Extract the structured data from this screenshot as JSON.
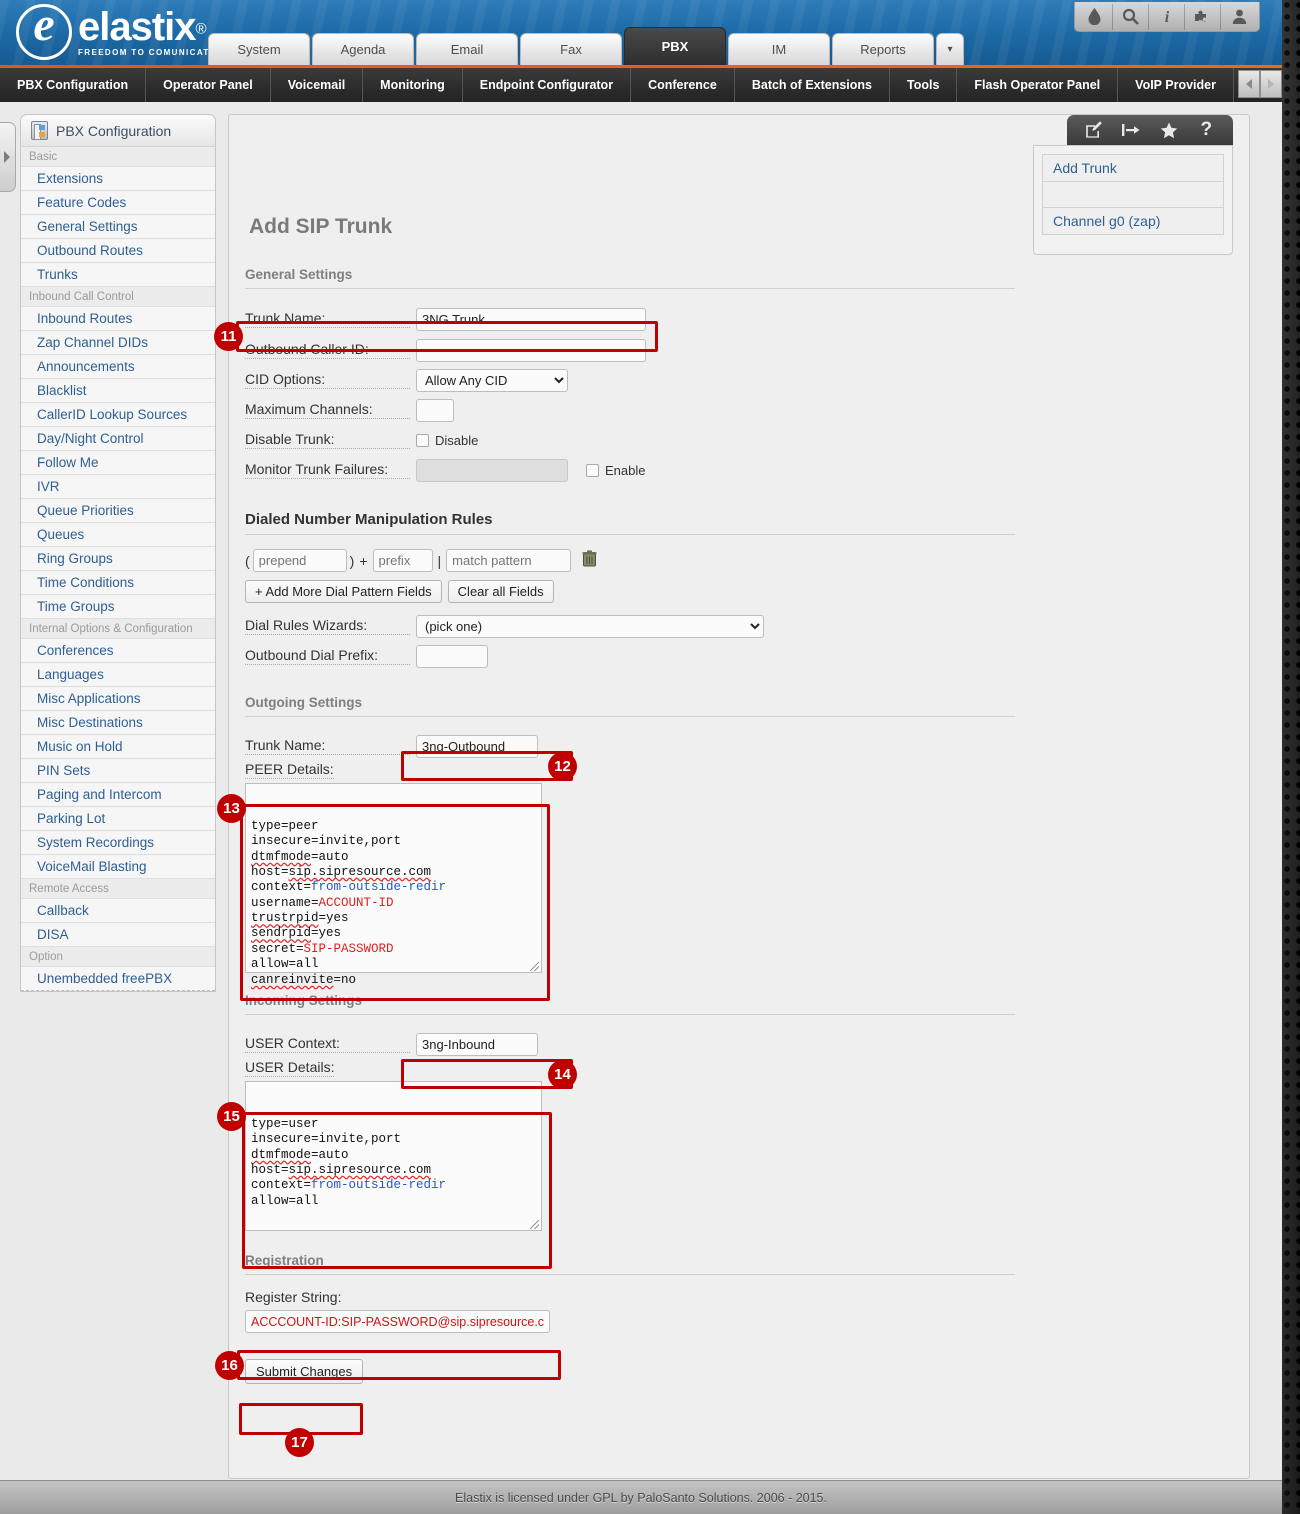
{
  "header": {
    "logo_text": "elastix",
    "logo_reg": "®",
    "logo_tagline": "FREEDOM TO COMUNICATE",
    "tabs": [
      {
        "label": "System",
        "active": false
      },
      {
        "label": "Agenda",
        "active": false
      },
      {
        "label": "Email",
        "active": false
      },
      {
        "label": "Fax",
        "active": false
      },
      {
        "label": "PBX",
        "active": true
      },
      {
        "label": "IM",
        "active": false
      },
      {
        "label": "Reports",
        "active": false
      }
    ],
    "tab_overflow": "▾",
    "tools": [
      {
        "name": "droplet-icon",
        "title": "droplet"
      },
      {
        "name": "search-icon",
        "title": "search"
      },
      {
        "name": "info-icon",
        "title": "info"
      },
      {
        "name": "puzzle-icon",
        "title": "extensions"
      },
      {
        "name": "user-icon",
        "title": "user"
      }
    ]
  },
  "subnav": {
    "items": [
      "PBX Configuration",
      "Operator Panel",
      "Voicemail",
      "Monitoring",
      "Endpoint Configurator",
      "Conference",
      "Batch of Extensions",
      "Tools",
      "Flash Operator Panel",
      "VoIP Provider"
    ],
    "scroll_left": "◀",
    "scroll_right": "▶"
  },
  "sidebar": {
    "tab_title": "PBX Configuration",
    "groups": [
      {
        "label": "Basic",
        "items": [
          "Extensions",
          "Feature Codes",
          "General Settings",
          "Outbound Routes",
          "Trunks"
        ]
      },
      {
        "label": "Inbound Call Control",
        "items": [
          "Inbound Routes",
          "Zap Channel DIDs",
          "Announcements",
          "Blacklist",
          "CallerID Lookup Sources",
          "Day/Night Control",
          "Follow Me",
          "IVR",
          "Queue Priorities",
          "Queues",
          "Ring Groups",
          "Time Conditions",
          "Time Groups"
        ]
      },
      {
        "label": "Internal Options & Configuration",
        "items": [
          "Conferences",
          "Languages",
          "Misc Applications",
          "Misc Destinations",
          "Music on Hold",
          "PIN Sets",
          "Paging and Intercom",
          "Parking Lot",
          "System Recordings",
          "VoiceMail Blasting"
        ]
      },
      {
        "label": "Remote Access",
        "items": [
          "Callback",
          "DISA"
        ]
      },
      {
        "label": "Option",
        "items": [
          "Unembedded freePBX"
        ]
      }
    ]
  },
  "main": {
    "page_title": "Add SIP Trunk",
    "general": {
      "heading": "General Settings",
      "trunk_name_label": "Trunk Name:",
      "trunk_name_value": "3NG Trunk",
      "outbound_cid_label": "Outbound Caller ID:",
      "outbound_cid_value": "",
      "cid_options_label": "CID Options:",
      "cid_options_value": "Allow Any CID",
      "cid_options_list": [
        "Allow Any CID"
      ],
      "max_channels_label": "Maximum Channels:",
      "max_channels_value": "",
      "disable_trunk_label": "Disable Trunk:",
      "disable_checkbox_label": "Disable",
      "monitor_label": "Monitor Trunk Failures:",
      "monitor_value": "",
      "enable_checkbox_label": "Enable"
    },
    "dial_rules": {
      "heading": "Dialed Number Manipulation Rules",
      "prepend_placeholder": "prepend",
      "open_paren": "(",
      "close_paren": ")",
      "plus": "+",
      "prefix_placeholder": "prefix",
      "pipe": "|",
      "match_placeholder": "match pattern",
      "trash_icon": "trash-icon",
      "add_more_label": "+ Add More Dial Pattern Fields",
      "clear_label": "Clear all Fields",
      "wizards_label": "Dial Rules Wizards:",
      "wizards_value": "(pick one)",
      "wizards_list": [
        "(pick one)"
      ],
      "outbound_prefix_label": "Outbound Dial Prefix:",
      "outbound_prefix_value": ""
    },
    "outgoing": {
      "heading": "Outgoing Settings",
      "trunk_name_label": "Trunk Name:",
      "trunk_name_value": "3ng-Outbound",
      "peer_details_label": "PEER Details:",
      "peer_details_lines": [
        "type=peer",
        "insecure=invite,port",
        "dtmfmode=auto",
        "host=sip.sipresource.com",
        "context=from-outside-redir",
        "username=ACCOUNT-ID",
        "trustrpid=yes",
        "sendrpid=yes",
        "secret=SIP-PASSWORD",
        "allow=all",
        "canreinvite=no"
      ]
    },
    "incoming": {
      "heading": "Incoming Settings",
      "user_context_label": "USER Context:",
      "user_context_value": "3ng-Inbound",
      "user_details_label": "USER Details:",
      "user_details_lines": [
        "type=user",
        "insecure=invite,port",
        "dtmfmode=auto",
        "host=sip.sipresource.com",
        "context=from-outside-redir",
        "allow=all"
      ]
    },
    "registration": {
      "heading": "Registration",
      "register_string_label": "Register String:",
      "register_string_value": "ACCCOUNT-ID:SIP-PASSWORD@sip.sipresource.co"
    },
    "submit_label": "Submit Changes"
  },
  "right_panel": {
    "tools": [
      {
        "name": "edit-icon"
      },
      {
        "name": "export-icon"
      },
      {
        "name": "star-icon"
      },
      {
        "name": "help-icon",
        "glyph": "?"
      }
    ],
    "items": [
      "Add Trunk",
      "",
      "Channel g0 (zap)"
    ]
  },
  "annotations": [
    {
      "number": "11",
      "target": "trunk-name-general"
    },
    {
      "number": "12",
      "target": "trunk-name-outgoing"
    },
    {
      "number": "13",
      "target": "peer-details"
    },
    {
      "number": "14",
      "target": "user-context"
    },
    {
      "number": "15",
      "target": "user-details"
    },
    {
      "number": "16",
      "target": "register-string"
    },
    {
      "number": "17",
      "target": "submit-changes"
    }
  ],
  "footer": {
    "text": "Elastix is licensed under GPL by PaloSanto Solutions. 2006 - 2015."
  },
  "colors": {
    "accent_orange": "#e2561f",
    "header_blue": "#1d6ba8",
    "highlight_red": "#c00000",
    "link_blue": "#2f5f92"
  }
}
